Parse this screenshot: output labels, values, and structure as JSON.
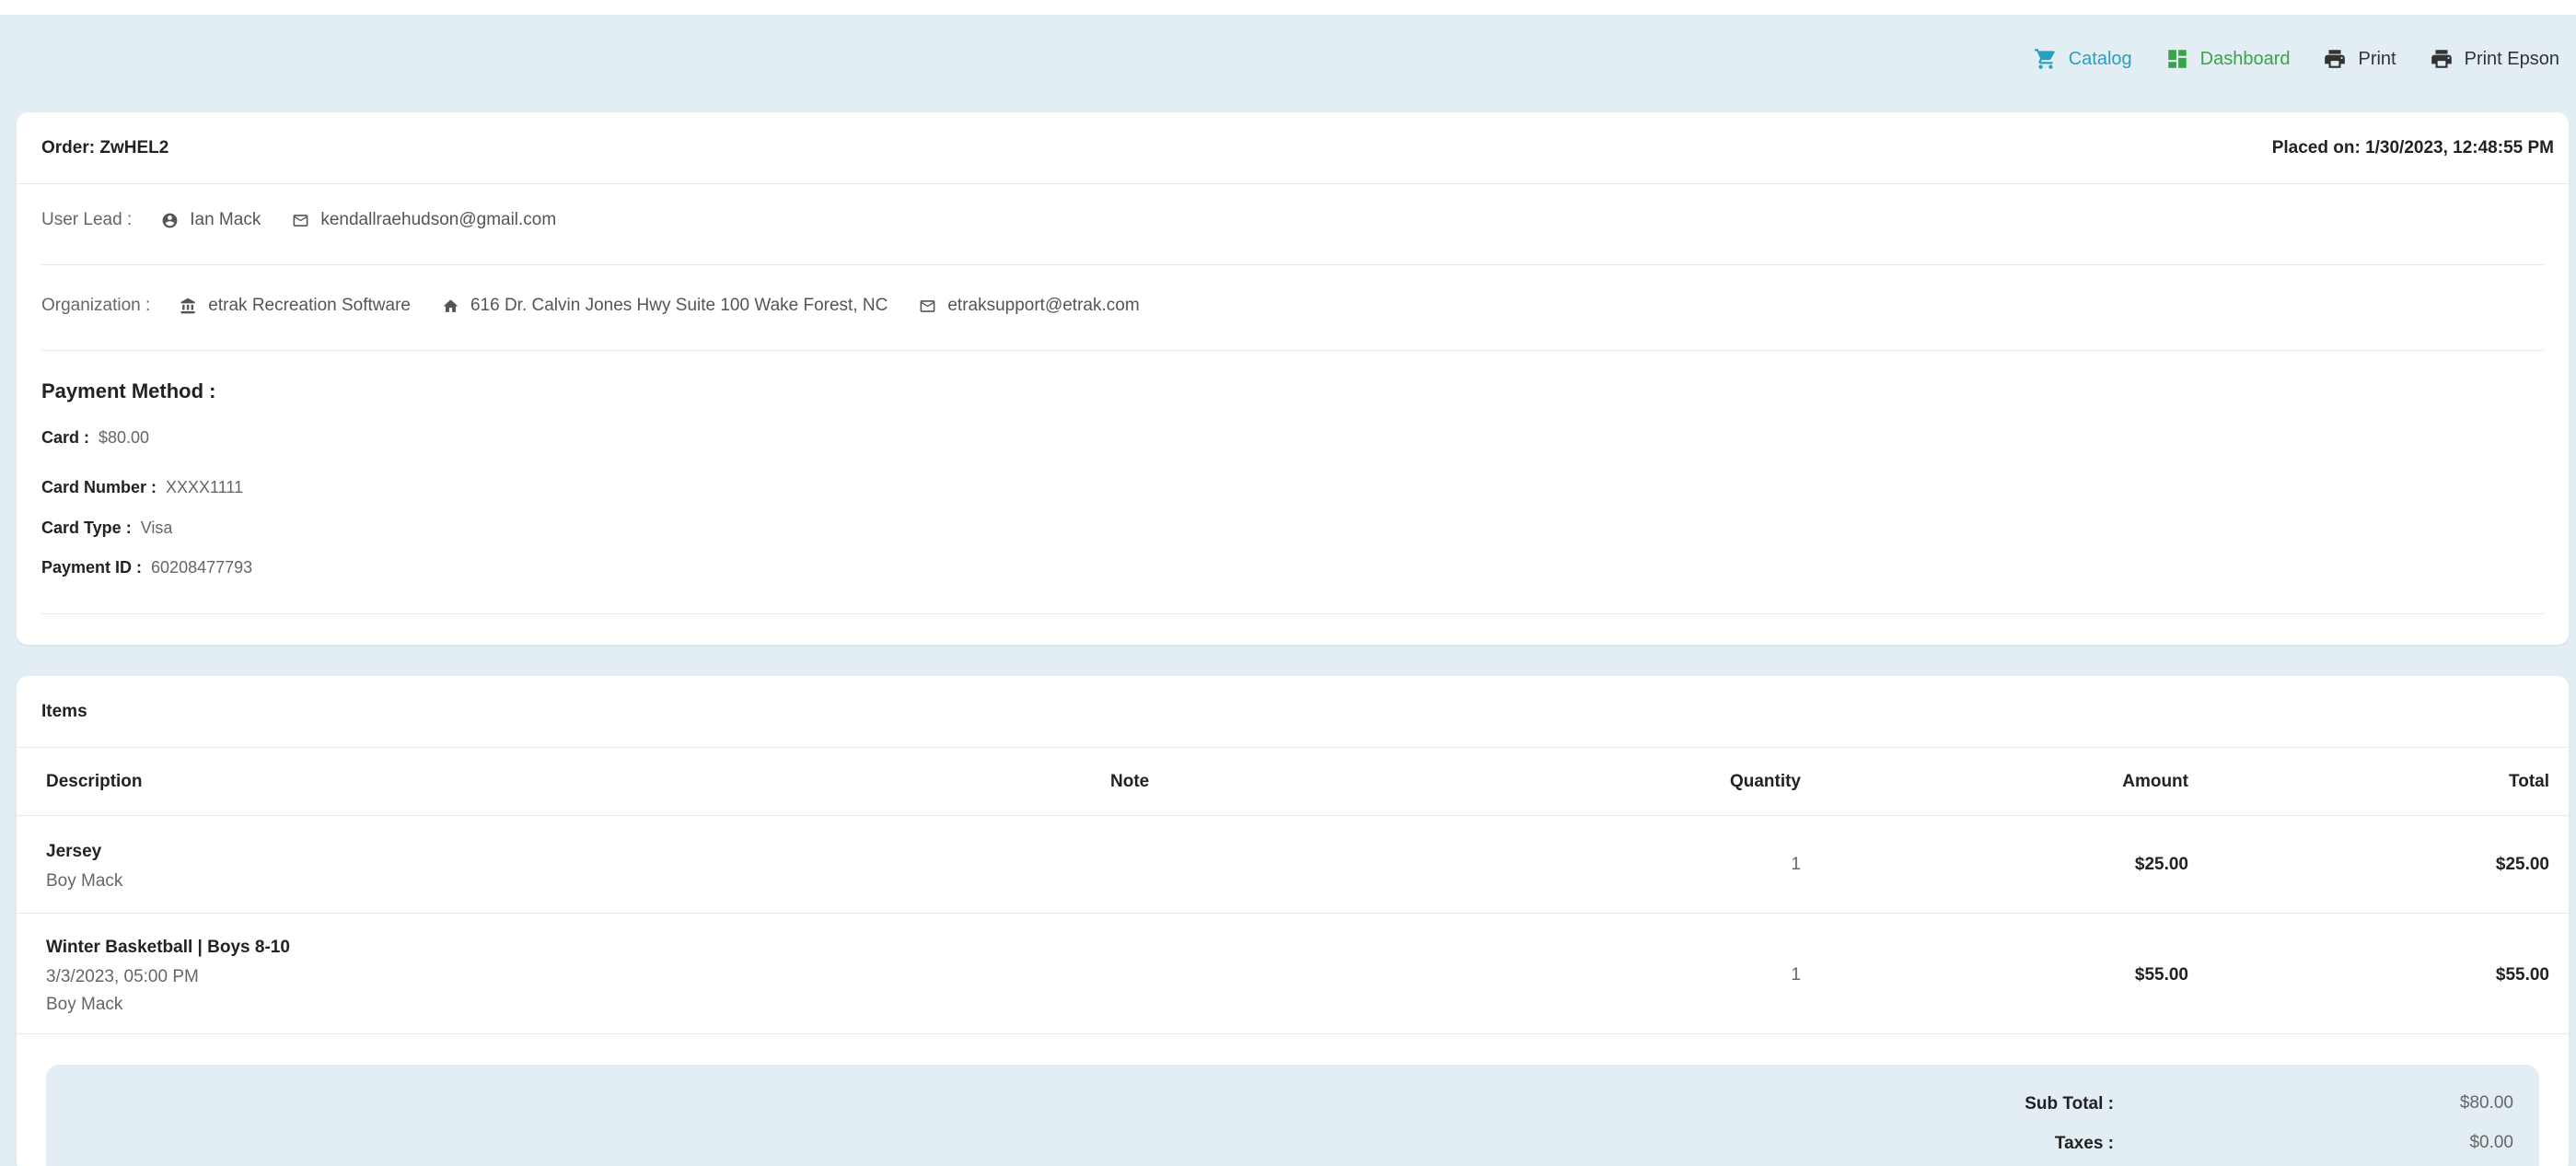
{
  "toolbar": {
    "catalog": "Catalog",
    "dashboard": "Dashboard",
    "print": "Print",
    "print_epson": "Print Epson"
  },
  "order": {
    "title": "Order: ZwHEL2",
    "placed_on": "Placed on: 1/30/2023, 12:48:55 PM",
    "user_lead_label": "User Lead :",
    "user_name": "Ian Mack",
    "user_email": "kendallraehudson@gmail.com",
    "organization_label": "Organization :",
    "org_name": "etrak Recreation Software",
    "org_address": "616 Dr. Calvin Jones Hwy Suite 100 Wake Forest, NC",
    "org_email": "etraksupport@etrak.com"
  },
  "payment": {
    "title": "Payment Method :",
    "card_label": "Card :",
    "card_value": "$80.00",
    "card_number_label": "Card Number :",
    "card_number_value": "XXXX1111",
    "card_type_label": "Card Type :",
    "card_type_value": "Visa",
    "payment_id_label": "Payment ID :",
    "payment_id_value": "60208477793"
  },
  "items": {
    "title": "Items",
    "columns": {
      "description": "Description",
      "note": "Note",
      "quantity": "Quantity",
      "amount": "Amount",
      "total": "Total"
    },
    "rows": [
      {
        "title": "Jersey",
        "sub1": "Boy Mack",
        "sub2": "",
        "note": "",
        "quantity": "1",
        "amount": "$25.00",
        "total": "$25.00"
      },
      {
        "title": "Winter Basketball | Boys 8-10",
        "sub1": "3/3/2023, 05:00 PM",
        "sub2": "Boy Mack",
        "note": "",
        "quantity": "1",
        "amount": "$55.00",
        "total": "$55.00"
      }
    ]
  },
  "totals": {
    "subtotal_label": "Sub Total :",
    "subtotal_value": "$80.00",
    "taxes_label": "Taxes :",
    "taxes_value": "$0.00"
  },
  "colors": {
    "background": "#e2eef3",
    "catalog": "#2a9fc2",
    "dashboard": "#3aa34a"
  },
  "icons": {
    "catalog": "cart-icon",
    "dashboard": "dashboard-icon",
    "print": "printer-icon",
    "user": "account-circle-icon",
    "email": "envelope-icon",
    "organization": "bank-icon",
    "address": "home-icon"
  }
}
